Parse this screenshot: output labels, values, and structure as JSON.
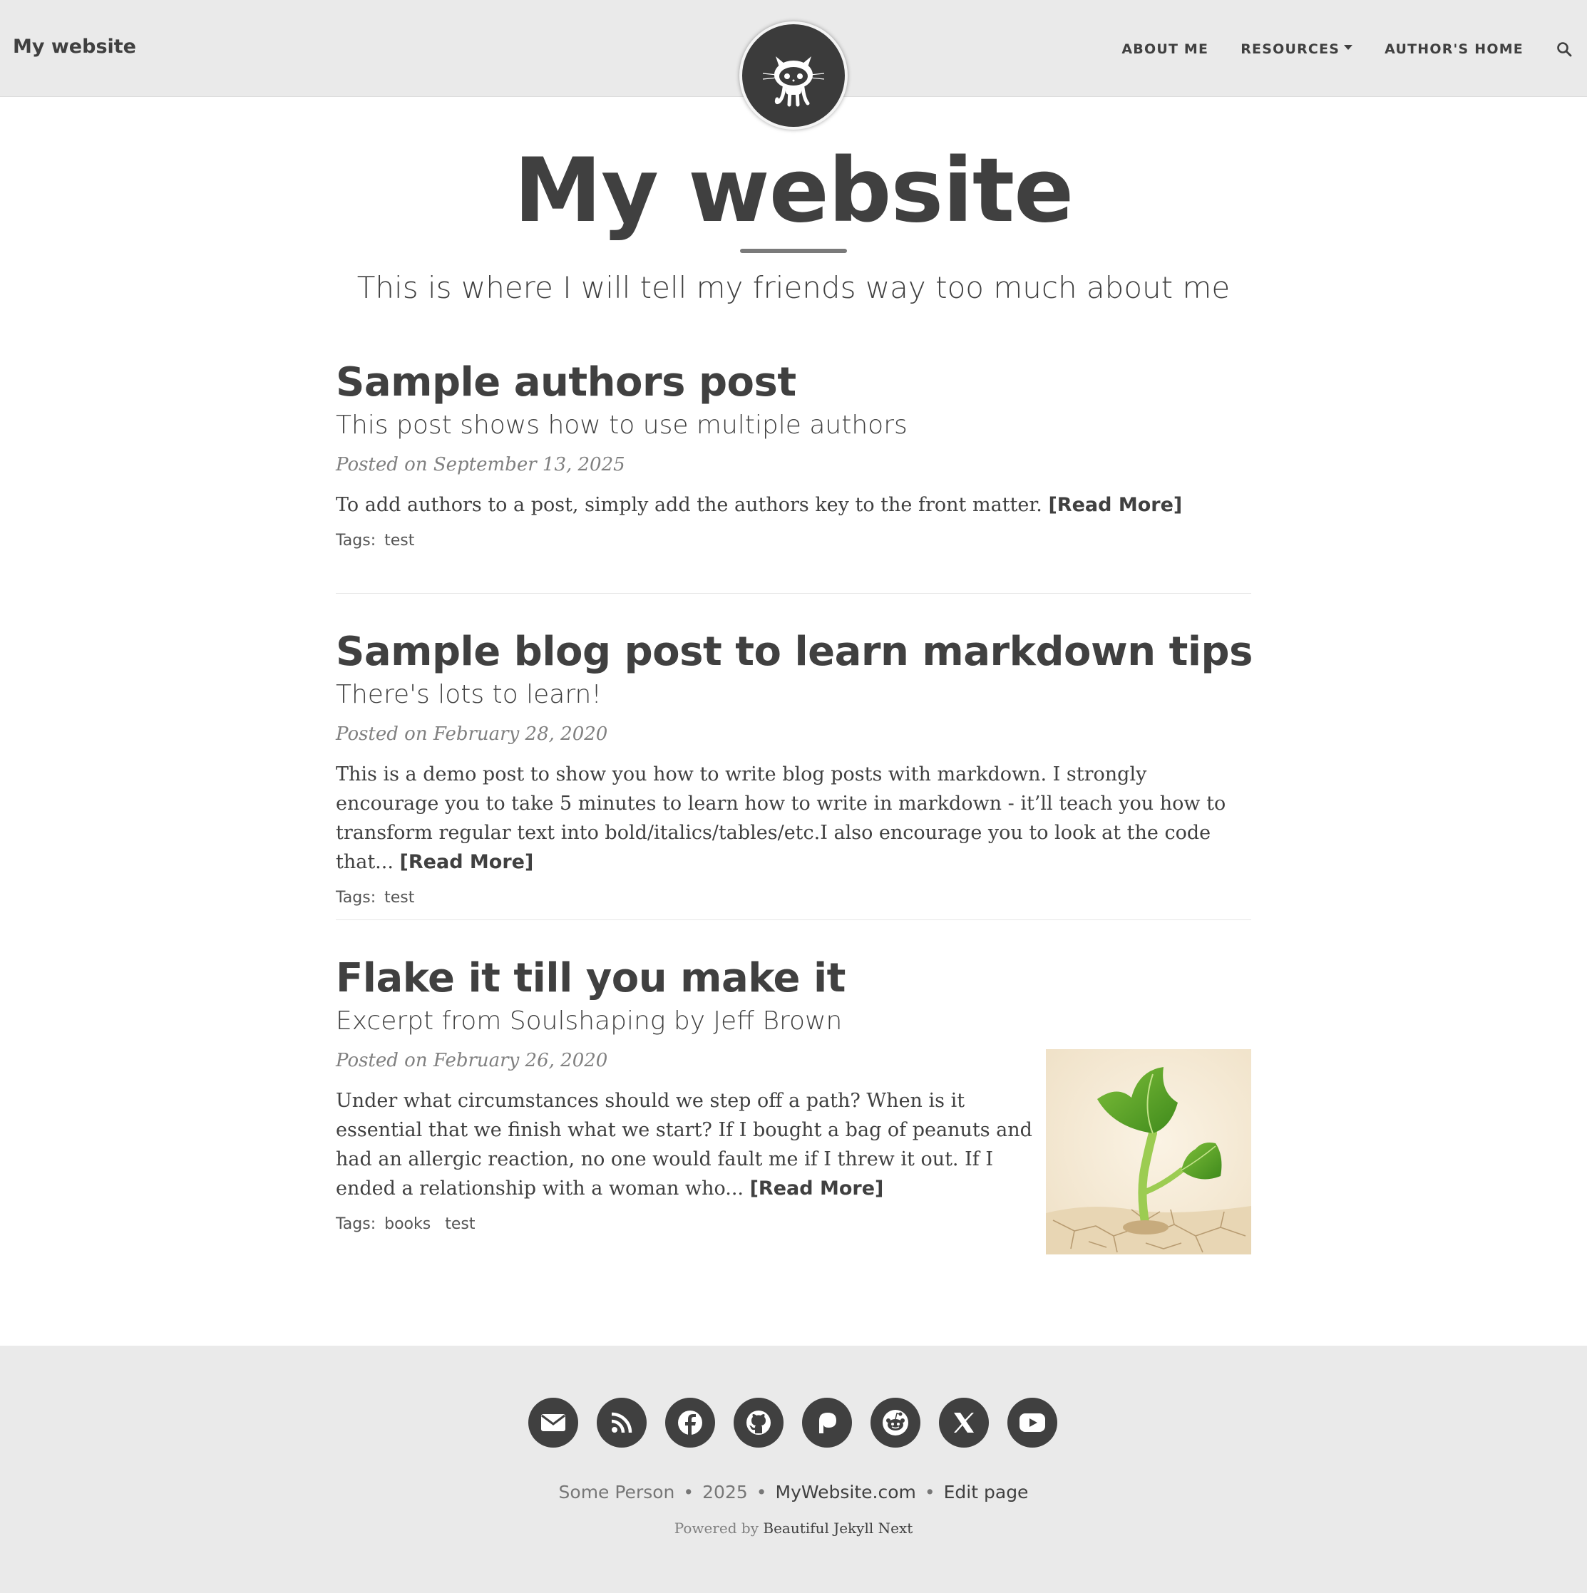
{
  "navbar": {
    "brand": "My website",
    "links": [
      {
        "label": "ABOUT ME"
      },
      {
        "label": "RESOURCES"
      },
      {
        "label": "AUTHOR'S HOME"
      }
    ]
  },
  "header": {
    "title": "My website",
    "subtitle": "This is where I will tell my friends way too much about me"
  },
  "posts": [
    {
      "title": "Sample authors post",
      "subtitle": "This post shows how to use multiple authors",
      "meta": "Posted on September 13, 2025",
      "excerpt": "To add authors to a post, simply add the authors key to the front matter.",
      "read_more": "[Read More]",
      "tags_label": "Tags:",
      "tags": [
        "test"
      ]
    },
    {
      "title": "Sample blog post to learn markdown tips",
      "subtitle": "There's lots to learn!",
      "meta": "Posted on February 28, 2020",
      "excerpt": "This is a demo post to show you how to write blog posts with markdown. I strongly encourage you to take 5 minutes to learn how to write in markdown - it’ll teach you how to transform regular text into bold/italics/tables/etc.I also encourage you to look at the code that...",
      "read_more": "[Read More]",
      "tags_label": "Tags:",
      "tags": [
        "test"
      ]
    },
    {
      "title": "Flake it till you make it",
      "subtitle": "Excerpt from Soulshaping by Jeff Brown",
      "meta": "Posted on February 26, 2020",
      "excerpt": "Under what circumstances should we step off a path? When is it essential that we finish what we start? If I bought a bag of peanuts and had an allergic reaction, no one would fault me if I threw it out. If I ended a relationship with a woman who...",
      "read_more": "[Read More]",
      "tags_label": "Tags:",
      "tags": [
        "books",
        "test"
      ]
    }
  ],
  "footer": {
    "social_icons": [
      "email-icon",
      "rss-icon",
      "facebook-icon",
      "github-icon",
      "patreon-icon",
      "reddit-icon",
      "x-icon",
      "youtube-icon"
    ],
    "author": "Some Person",
    "year": "2025",
    "site": "MyWebsite.com",
    "edit": "Edit page",
    "powered_prefix": "Powered by",
    "powered_link": "Beautiful Jekyll Next",
    "separator": "•"
  },
  "colors": {
    "text": "#404040",
    "navbar_bg": "#eaeaea",
    "footer_bg": "#eaeaea",
    "meta": "#808080",
    "avatar_bg": "#3b3b3b"
  }
}
